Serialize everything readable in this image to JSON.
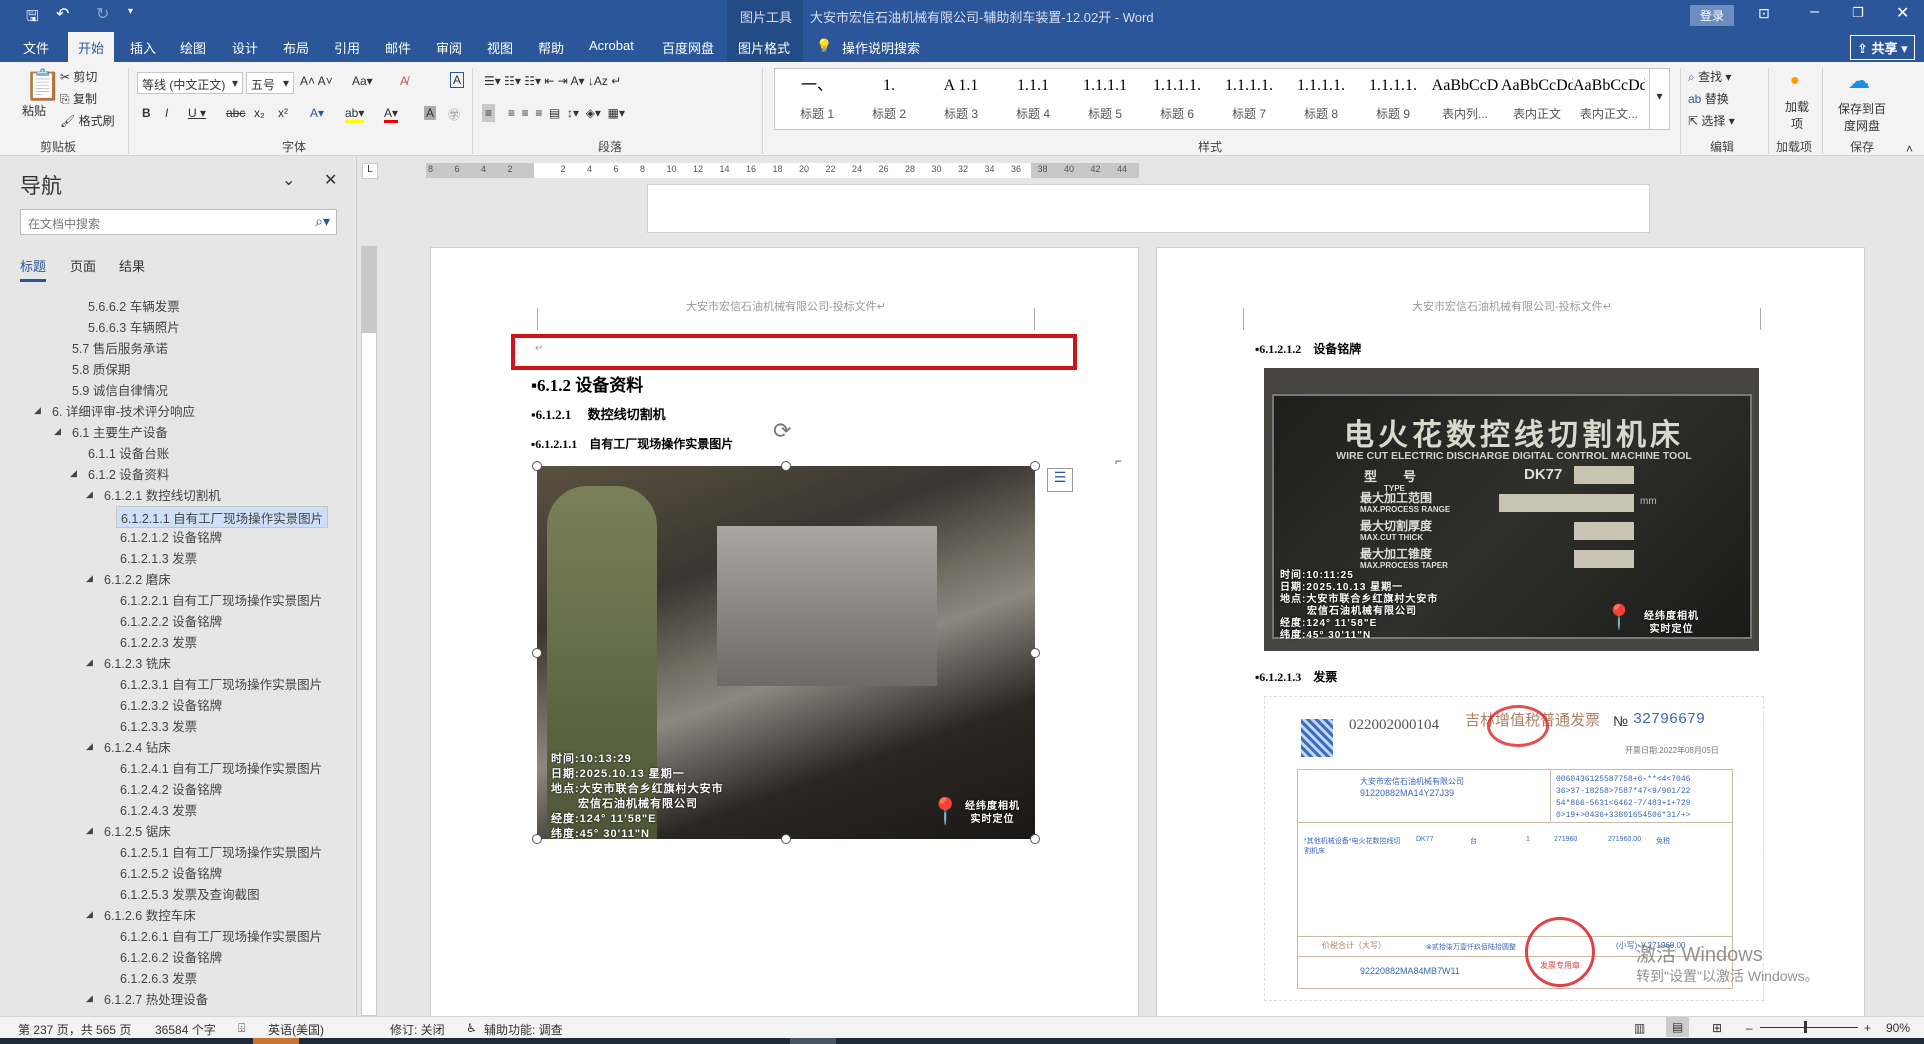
{
  "titlebar": {
    "tool_context": "图片工具",
    "doc_title": "大安市宏信石油机械有限公司-辅助刹车装置-12.02开  -  Word",
    "login": "登录"
  },
  "tabs": [
    "文件",
    "开始",
    "插入",
    "绘图",
    "设计",
    "布局",
    "引用",
    "邮件",
    "审阅",
    "视图",
    "帮助",
    "Acrobat",
    "百度网盘",
    "图片格式"
  ],
  "tell_me": "操作说明搜索",
  "share": "共享",
  "ribbon": {
    "clipboard": {
      "paste": "粘贴",
      "cut": "剪切",
      "copy": "复制",
      "format_painter": "格式刷",
      "label": "剪贴板"
    },
    "font": {
      "name": "等线 (中文正文)",
      "size": "五号",
      "label": "字体"
    },
    "paragraph": {
      "label": "段落"
    },
    "styles": {
      "label": "样式",
      "items": [
        {
          "pv": "一、",
          "nm": "标题 1"
        },
        {
          "pv": "1.",
          "nm": "标题 2"
        },
        {
          "pv": "A 1.1",
          "nm": "标题 3"
        },
        {
          "pv": "1.1.1",
          "nm": "标题 4"
        },
        {
          "pv": "1.1.1.1",
          "nm": "标题 5"
        },
        {
          "pv": "1.1.1.1.",
          "nm": "标题 6"
        },
        {
          "pv": "1.1.1.1.",
          "nm": "标题 7"
        },
        {
          "pv": "1.1.1.1.",
          "nm": "标题 8"
        },
        {
          "pv": "1.1.1.1.",
          "nm": "标题 9"
        },
        {
          "pv": "AaBbCcD",
          "nm": "表内列..."
        },
        {
          "pv": "AaBbCcDdI",
          "nm": "表内正文"
        },
        {
          "pv": "AaBbCcDdI",
          "nm": "表内正文..."
        }
      ]
    },
    "editing": {
      "find": "查找",
      "replace": "替换",
      "select": "选择",
      "label": "编辑"
    },
    "addins": {
      "btn": "加载项",
      "label": "加载项"
    },
    "save": {
      "btn": "保存到百度网盘",
      "label": "保存"
    }
  },
  "nav": {
    "title": "导航",
    "search_placeholder": "在文档中搜索",
    "tabs": [
      "标题",
      "页面",
      "结果"
    ],
    "items": [
      {
        "t": "5.6.6.2 车辆发票",
        "l": 3,
        "e": false
      },
      {
        "t": "5.6.6.3 车辆照片",
        "l": 3,
        "e": false
      },
      {
        "t": "5.7 售后服务承诺",
        "l": 2,
        "e": false
      },
      {
        "t": "5.8 质保期",
        "l": 2,
        "e": false
      },
      {
        "t": "5.9 诚信自律情况",
        "l": 2,
        "e": false
      },
      {
        "t": "6. 详细评审-技术评分响应",
        "l": 1,
        "e": true
      },
      {
        "t": "6.1 主要生产设备",
        "l": 2,
        "e": true
      },
      {
        "t": "6.1.1 设备台账",
        "l": 3,
        "e": false
      },
      {
        "t": "6.1.2 设备资料",
        "l": 3,
        "e": true
      },
      {
        "t": "6.1.2.1 数控线切割机",
        "l": 4,
        "e": true
      },
      {
        "t": "6.1.2.1.1 自有工厂现场操作实景图片",
        "l": 5,
        "e": false,
        "s": true
      },
      {
        "t": "6.1.2.1.2 设备铭牌",
        "l": 5,
        "e": false
      },
      {
        "t": "6.1.2.1.3 发票",
        "l": 5,
        "e": false
      },
      {
        "t": "6.1.2.2 磨床",
        "l": 4,
        "e": true
      },
      {
        "t": "6.1.2.2.1 自有工厂现场操作实景图片",
        "l": 5,
        "e": false
      },
      {
        "t": "6.1.2.2.2 设备铭牌",
        "l": 5,
        "e": false
      },
      {
        "t": "6.1.2.2.3 发票",
        "l": 5,
        "e": false
      },
      {
        "t": "6.1.2.3 铣床",
        "l": 4,
        "e": true
      },
      {
        "t": "6.1.2.3.1 自有工厂现场操作实景图片",
        "l": 5,
        "e": false
      },
      {
        "t": "6.1.2.3.2 设备铭牌",
        "l": 5,
        "e": false
      },
      {
        "t": "6.1.2.3.3 发票",
        "l": 5,
        "e": false
      },
      {
        "t": "6.1.2.4 钻床",
        "l": 4,
        "e": true
      },
      {
        "t": "6.1.2.4.1 自有工厂现场操作实景图片",
        "l": 5,
        "e": false
      },
      {
        "t": "6.1.2.4.2 设备铭牌",
        "l": 5,
        "e": false
      },
      {
        "t": "6.1.2.4.3 发票",
        "l": 5,
        "e": false
      },
      {
        "t": "6.1.2.5 锯床",
        "l": 4,
        "e": true
      },
      {
        "t": "6.1.2.5.1 自有工厂现场操作实景图片",
        "l": 5,
        "e": false
      },
      {
        "t": "6.1.2.5.2 设备铭牌",
        "l": 5,
        "e": false
      },
      {
        "t": "6.1.2.5.3 发票及查询截图",
        "l": 5,
        "e": false
      },
      {
        "t": "6.1.2.6 数控车床",
        "l": 4,
        "e": true
      },
      {
        "t": "6.1.2.6.1 自有工厂现场操作实景图片",
        "l": 5,
        "e": false
      },
      {
        "t": "6.1.2.6.2 设备铭牌",
        "l": 5,
        "e": false
      },
      {
        "t": "6.1.2.6.3 发票",
        "l": 5,
        "e": false
      },
      {
        "t": "6.1.2.7 热处理设备",
        "l": 4,
        "e": true
      }
    ]
  },
  "ruler": [
    "8",
    "6",
    "4",
    "2",
    "2",
    "4",
    "6",
    "8",
    "10",
    "12",
    "14",
    "16",
    "18",
    "20",
    "22",
    "24",
    "26",
    "28",
    "30",
    "32",
    "34",
    "36",
    "38",
    "40",
    "42",
    "44"
  ],
  "page1": {
    "header": "大安市宏信石油机械有限公司-投标文件↵",
    "h2": "6.1.2 设备资料",
    "h3": "6.1.2.1　 数控线切割机",
    "h4": "6.1.2.1.1　自有工厂现场操作实景图片",
    "photo": {
      "time": "时间:10:13:29",
      "date": "日期:2025.10.13 星期一",
      "place1": "地点:大安市联合乡红旗村大安市",
      "place2": "宏信石油机械有限公司",
      "lng": "经度:124°  11'58\"E",
      "lat": "纬度:45°  30'11\"N",
      "brand": "经纬度相机",
      "brand_sub": "实时定位"
    }
  },
  "page2": {
    "header": "大安市宏信石油机械有限公司-投标文件↵",
    "h_plate": "6.1.2.1.2　设备铭牌",
    "h_invoice": "6.1.2.1.3　发票",
    "plate": {
      "title": "电火花数控线切割机床",
      "subtitle": "WIRE CUT ELECTRIC DISCHARGE DIGITAL CONTROL MACHINE TOOL",
      "type_label": "型　　号",
      "type_en": "TYPE",
      "model": "DK77",
      "r1": "最大加工范围",
      "r1en": "MAX.PROCESS RANGE",
      "unit": "mm",
      "r2": "最大切割厚度",
      "r2en": "MAX.CUT THICK",
      "r3": "最大加工锥度",
      "r3en": "MAX.PROCESS TAPER",
      "time": "时间:10:11:25",
      "date": "日期:2025.10.13 星期一",
      "place1": "地点:大安市联合乡红旗村大安市",
      "place2": "宏信石油机械有限公司",
      "lng": "经度:124°  11'58\"E",
      "lat": "纬度:45°  30'11\"N",
      "brand": "经纬度相机",
      "brand_sub": "实时定位"
    },
    "invoice": {
      "code": "022002000104",
      "title": "吉林增值税普通发票",
      "no_label": "№",
      "no": "32796679",
      "date": "开票日期:2022年08月05日",
      "buyer": "大安市宏信石油机械有限公司",
      "buyer_tax": "91220882MA14Y27J39",
      "cipher1": "0060436125587758+6-**<4<7046",
      "cipher2": "36>37-18258>7587*47<9/901/22",
      "cipher3": "54*866-5631<6462-7/483+1+729",
      "cipher4": "0>19+>0436+33801654506*31/+>",
      "item": "*其他机械设备*电火花数控线切割机床",
      "model": "DK77",
      "unit": "台",
      "qty": "1",
      "price": "271960",
      "amount": "271960.00",
      "tax_rate": "免税",
      "total_label": "价税合计（大写）",
      "total_words": "⊗贰拾柒万壹仟玖佰陆拾圆整",
      "total_small": "(小写) ￥271960.00",
      "seller_tax": "92220882MA84MB7W11",
      "stamp": "发票专用章"
    }
  },
  "watermark": {
    "line1": "激活 Windows",
    "line2": "转到\"设置\"以激活 Windows。"
  },
  "status": {
    "page": "第 237 页，共 565 页",
    "words": "36584 个字",
    "lang": "英语(美国)",
    "track": "修订: 关闭",
    "access": "辅助功能: 调查",
    "zoom": "90%"
  }
}
